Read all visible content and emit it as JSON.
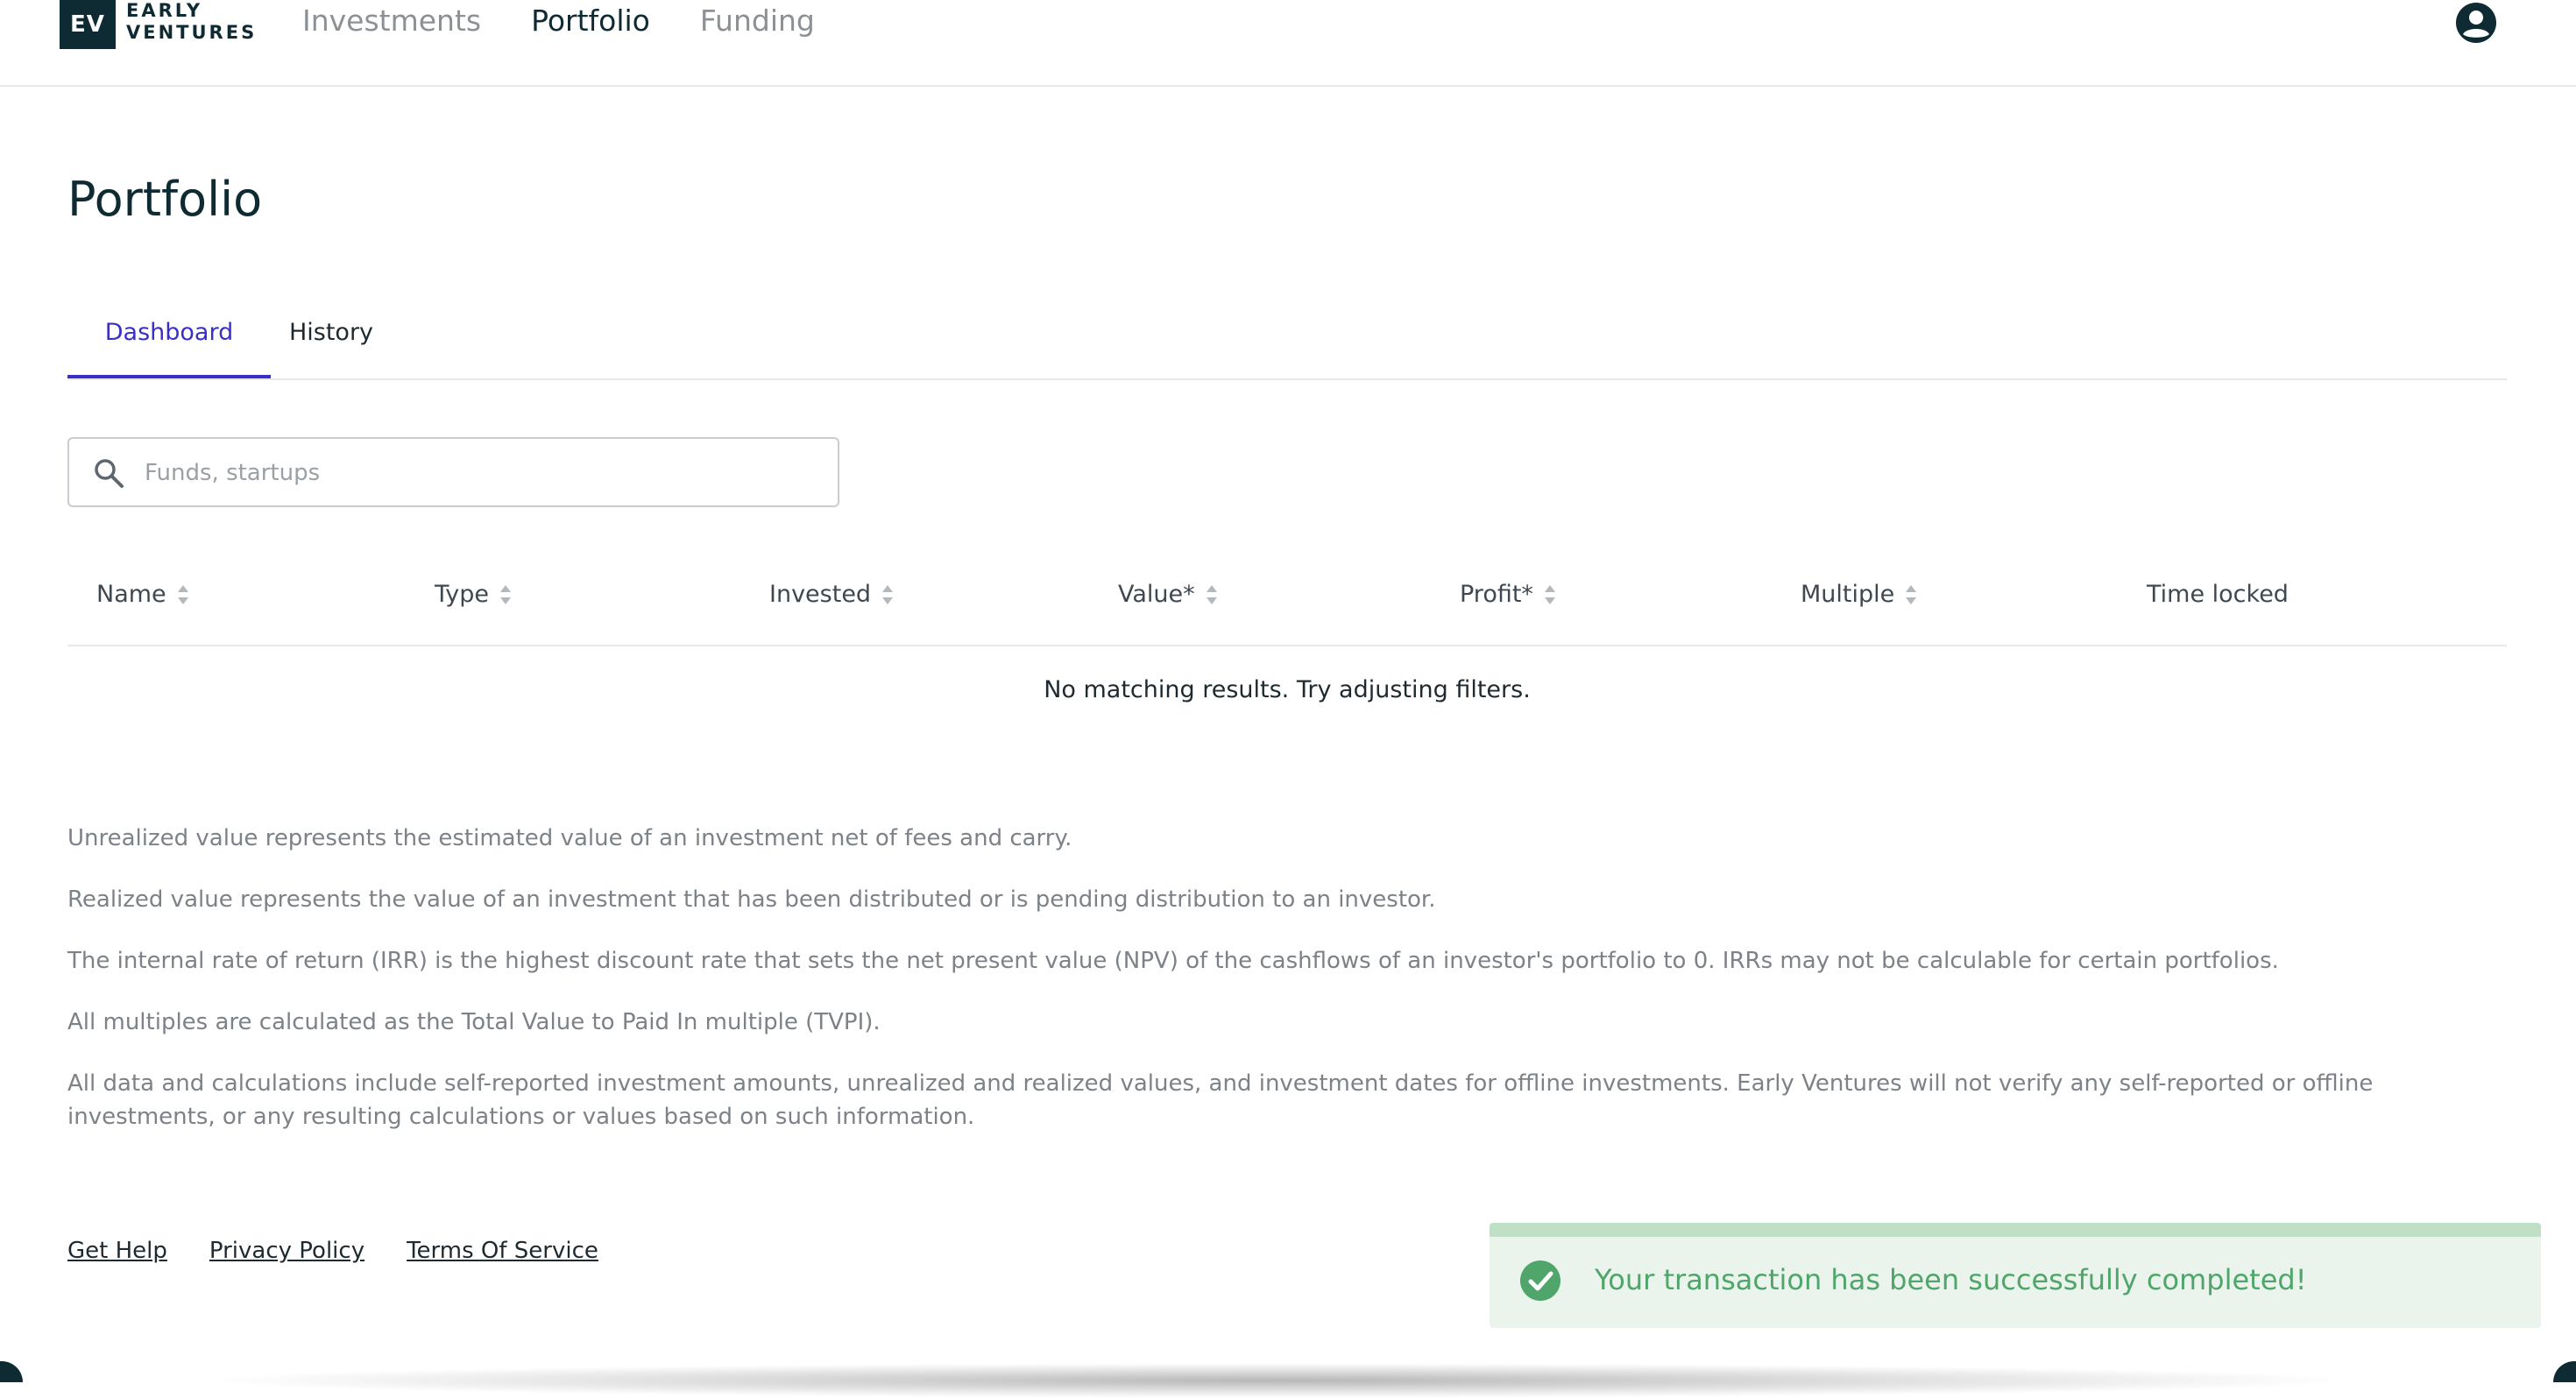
{
  "brand": {
    "mark": "EV",
    "line1": "EARLY",
    "line2": "VENTURES"
  },
  "nav": {
    "items": [
      "Investments",
      "Portfolio",
      "Funding"
    ],
    "active": "Portfolio"
  },
  "account": {
    "icon": "user-circle-icon"
  },
  "page": {
    "title": "Portfolio"
  },
  "tabs": {
    "items": [
      "Dashboard",
      "History"
    ],
    "active": "Dashboard"
  },
  "search": {
    "placeholder": "Funds, startups",
    "value": ""
  },
  "table": {
    "columns": [
      "Name",
      "Type",
      "Invested",
      "Value*",
      "Profit*",
      "Multiple",
      "Time locked"
    ],
    "sortable": [
      true,
      true,
      true,
      true,
      true,
      true,
      false
    ],
    "rows": [],
    "empty_message": "No matching results. Try adjusting filters."
  },
  "notes": [
    "Unrealized value represents the estimated value of an investment net of fees and carry.",
    "Realized value represents the value of an investment that has been distributed or is pending distribution to an investor.",
    "The internal rate of return (IRR) is the highest discount rate that sets the net present value (NPV) of the cashflows of an investor's portfolio to 0. IRRs may not be calculable for certain portfolios.",
    "All multiples are calculated as the Total Value to Paid In multiple (TVPI).",
    "All data and calculations include self-reported investment amounts, unrealized and realized values, and investment dates for offline investments. Early Ventures will not verify any self-reported or offline investments, or any resulting calculations or values based on such information."
  ],
  "footer": {
    "links": [
      "Get Help",
      "Privacy Policy",
      "Terms Of Service"
    ]
  },
  "toast": {
    "message": "Your transaction has been successfully completed!",
    "status": "success",
    "color": "#4fa56a"
  },
  "colors": {
    "brand": "#0e2a33",
    "accent": "#3b2fc9",
    "success": "#4fa56a"
  }
}
